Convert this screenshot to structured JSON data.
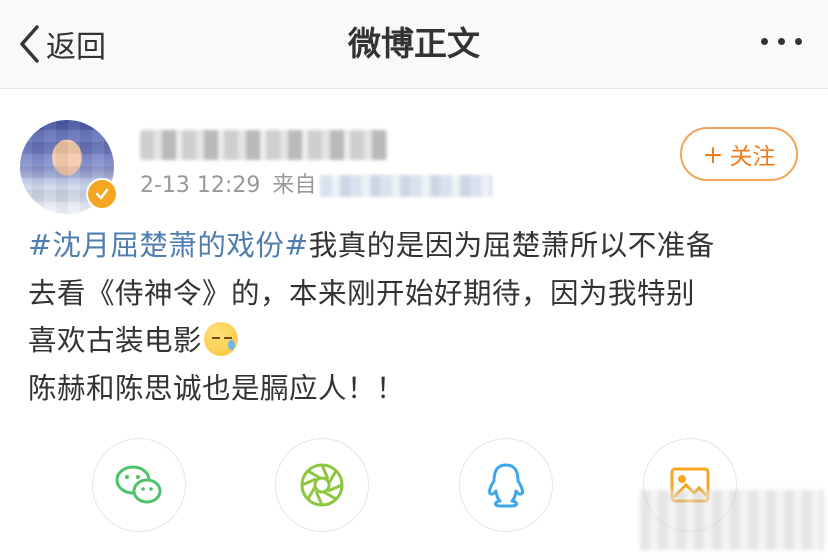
{
  "header": {
    "back_label": "返回",
    "title": "微博正文"
  },
  "post": {
    "time": "2-13 12:29",
    "source_prefix": "来自",
    "follow_label": "关注",
    "hashtag": "#沈月屈楚萧的戏份#",
    "text_line1": "我真的是因为屈楚萧所以不准备",
    "text_line2": "去看《侍神令》的，本来刚开始好期待，因为我特别",
    "text_line3": "喜欢古装电影",
    "text_line4": "陈赫和陈思诚也是膈应人！！"
  },
  "share": {
    "icons": [
      "wechat-icon",
      "moments-icon",
      "qq-icon",
      "image-icon"
    ]
  },
  "colors": {
    "link": "#507daf",
    "follow": "#f07c1e",
    "verified": "#f5a623"
  }
}
